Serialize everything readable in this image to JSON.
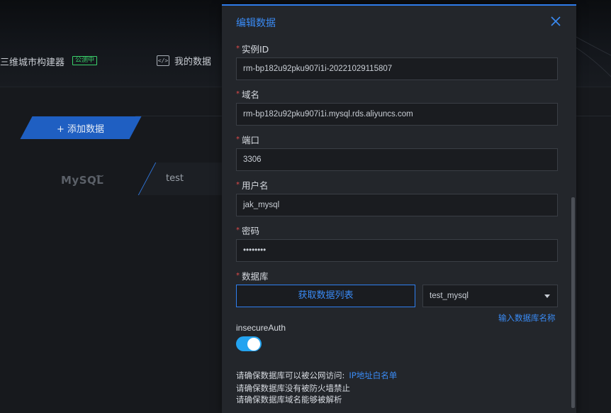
{
  "background": {
    "app_title": "三维城市构建器",
    "app_badge": "公测中",
    "nav_my_data": "我的数据",
    "add_data_button": "+ 添加数据",
    "card_brand": "MySQL",
    "card_name": "test"
  },
  "modal": {
    "title": "编辑数据",
    "fields": {
      "instance_id": {
        "label": "实例ID",
        "value": "rm-bp182u92pku907i1i-20221029115807"
      },
      "domain": {
        "label": "域名",
        "value": "rm-bp182u92pku907i1i.mysql.rds.aliyuncs.com"
      },
      "port": {
        "label": "端口",
        "value": "3306"
      },
      "username": {
        "label": "用户名",
        "value": "jak_mysql"
      },
      "password": {
        "label": "密码",
        "value": "••••••••"
      },
      "database": {
        "label": "数据库",
        "value": "test_mysql"
      }
    },
    "required_mark": "*",
    "fetch_list_button": "获取数据列表",
    "input_db_name_link": "输入数据库名称",
    "insecure_auth_label": "insecureAuth",
    "insecure_auth_on": true,
    "notes": {
      "line1": "请确保数据库可以被公网访问:",
      "line1_link": "IP地址白名单",
      "line2": "请确保数据库没有被防火墙禁止",
      "line3": "请确保数据库域名能够被解析"
    },
    "colors": {
      "accent": "#3a8bf5",
      "toggle_on": "#23a3f0",
      "required": "#e04a4a"
    }
  }
}
